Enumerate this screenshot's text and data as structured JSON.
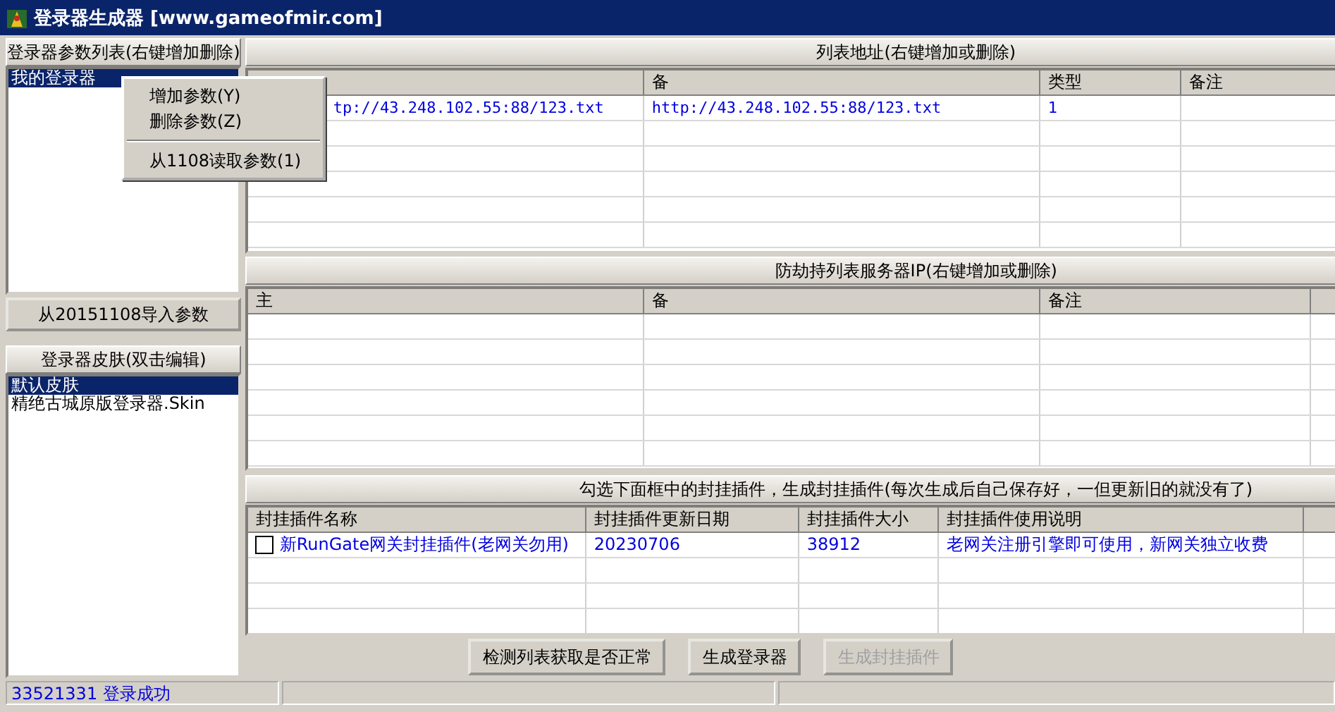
{
  "window": {
    "title": "登录器生成器 [www.gameofmir.com]"
  },
  "params_panel": {
    "header": "登录器参数列表(右键增加删除)",
    "items": [
      {
        "label": "我的登录器",
        "selected": true
      }
    ],
    "import_button": "从20151108导入参数"
  },
  "context_menu": {
    "items": [
      {
        "kind": "item",
        "label": "增加参数(Y)"
      },
      {
        "kind": "item",
        "label": "删除参数(Z)"
      },
      {
        "kind": "separator"
      },
      {
        "kind": "item",
        "label": "从1108读取参数(1)"
      }
    ]
  },
  "skin_panel": {
    "header": "登录器皮肤(双击编辑)",
    "items": [
      {
        "label": "默认皮肤",
        "selected": true
      },
      {
        "label": "精绝古城原版登录器.Skin",
        "selected": false
      }
    ]
  },
  "list_table": {
    "header": "列表地址(右键增加或删除)",
    "columns": [
      {},
      {
        "label": "备"
      },
      {
        "label": "类型"
      },
      {
        "label": "备注"
      }
    ],
    "rows": [
      [
        "tp://43.248.102.55:88/123.txt",
        "http://43.248.102.55:88/123.txt",
        "1",
        ""
      ]
    ]
  },
  "ip_table": {
    "header": "防劫持列表服务器IP(右键增加或删除)",
    "columns": [
      {
        "label": "主"
      },
      {
        "label": "备"
      },
      {
        "label": "备注"
      }
    ]
  },
  "plugin_table": {
    "header": "勾选下面框中的封挂插件，生成封挂插件(每次生成后自己保存好，一但更新旧的就没有了)",
    "columns": [
      {
        "label": "封挂插件名称"
      },
      {
        "label": "封挂插件更新日期"
      },
      {
        "label": "封挂插件大小"
      },
      {
        "label": "封挂插件使用说明"
      }
    ],
    "rows": [
      {
        "checked": false,
        "name": "新RunGate网关封挂插件(老网关勿用)",
        "date": "20230706",
        "size": "38912",
        "description": "老网关注册引擎即可使用，新网关独立收费"
      }
    ]
  },
  "buttons": [
    {
      "label": "检测列表获取是否正常",
      "disabled": false
    },
    {
      "label": "生成登录器",
      "disabled": false
    },
    {
      "label": "生成封挂插件",
      "disabled": true
    }
  ],
  "status_bar": {
    "text": "33521331 登录成功"
  }
}
